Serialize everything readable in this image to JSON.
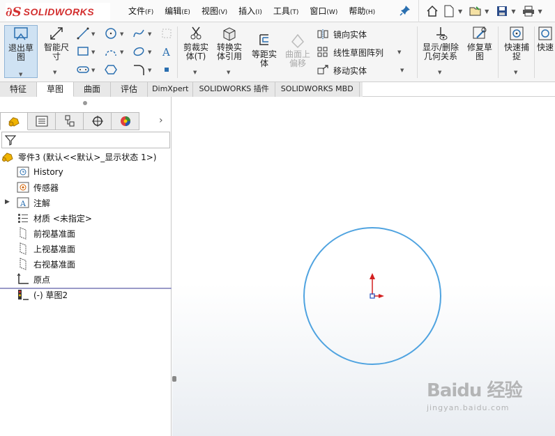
{
  "app": {
    "logo_mark": "∂S",
    "logo_text": "SOLIDWORKS"
  },
  "menu": [
    {
      "label": "文件",
      "acc": "(F)"
    },
    {
      "label": "编辑",
      "acc": "(E)"
    },
    {
      "label": "视图",
      "acc": "(V)"
    },
    {
      "label": "插入",
      "acc": "(I)"
    },
    {
      "label": "工具",
      "acc": "(T)"
    },
    {
      "label": "窗口",
      "acc": "(W)"
    },
    {
      "label": "帮助",
      "acc": "(H)"
    }
  ],
  "ribbon": {
    "exit_sketch": "退出草图",
    "smart_dimension": "智能尺寸",
    "trim_entities": "剪裁实体(T)",
    "convert_entities": "转换实体引用",
    "offset_entities": "等距实体",
    "offset_on_surface": "曲面上偏移",
    "mirror_entities": "镜向实体",
    "linear_pattern": "线性草图阵列",
    "move_entities": "移动实体",
    "display_relations": "显示/删除几何关系",
    "repair_sketch": "修复草图",
    "quick_snaps": "快速捕捉",
    "quick_view": "快速"
  },
  "tabs": [
    {
      "label": "特征",
      "active": false
    },
    {
      "label": "草图",
      "active": true
    },
    {
      "label": "曲面",
      "active": false
    },
    {
      "label": "评估",
      "active": false
    },
    {
      "label": "DimXpert",
      "active": false
    },
    {
      "label": "SOLIDWORKS 插件",
      "active": false
    },
    {
      "label": "SOLIDWORKS MBD",
      "active": false
    }
  ],
  "tree": {
    "root": "零件3 (默认<<默认>_显示状态 1>)",
    "history": "History",
    "sensors": "传感器",
    "annotations": "注解",
    "material": "材质 <未指定>",
    "front_plane": "前视基准面",
    "top_plane": "上视基准面",
    "right_plane": "右视基准面",
    "origin": "原点",
    "sketch2": "(-) 草图2"
  },
  "colors": {
    "sketch_circle": "#4fa3e0",
    "origin_red": "#d32020",
    "origin_blue": "#2050c0",
    "logo_red": "#d32f2f"
  },
  "watermark": {
    "main": "Baidu 经验",
    "sub": "jingyan.baidu.com"
  }
}
